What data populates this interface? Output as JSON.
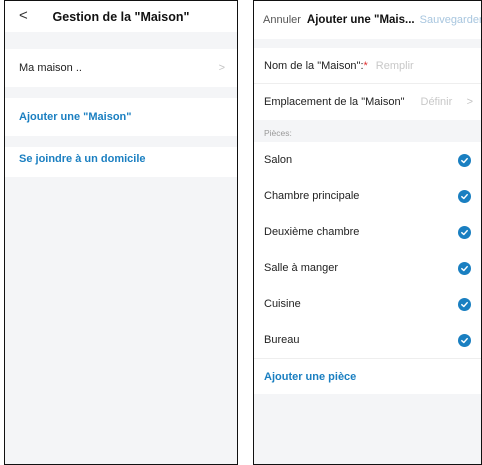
{
  "left": {
    "title": "Gestion de la \"Maison\"",
    "back_glyph": "<",
    "home_item": "Ma maison ..",
    "home_chevron": ">",
    "add_home": "Ajouter une \"Maison\"",
    "join_home": "Se joindre à un domicile"
  },
  "right": {
    "cancel": "Annuler",
    "title": "Ajouter une \"Mais...",
    "save": "Sauvegarder",
    "name_label": "Nom de la \"Maison\":",
    "name_required": "*",
    "name_placeholder": "Remplir",
    "location_label": "Emplacement de la \"Maison\"",
    "location_value": "Définir",
    "location_chevron": ">",
    "rooms_label": "Pièces:",
    "rooms": [
      {
        "name": "Salon",
        "checked": true
      },
      {
        "name": "Chambre principale",
        "checked": true
      },
      {
        "name": "Deuxième chambre",
        "checked": true
      },
      {
        "name": "Salle à manger",
        "checked": true
      },
      {
        "name": "Cuisine",
        "checked": true
      },
      {
        "name": "Bureau",
        "checked": true
      }
    ],
    "add_room": "Ajouter une pièce"
  },
  "colors": {
    "accent": "#1a7fc1",
    "background": "#f4f5f7",
    "required": "#e03030",
    "save_disabled": "#a8c6df"
  }
}
